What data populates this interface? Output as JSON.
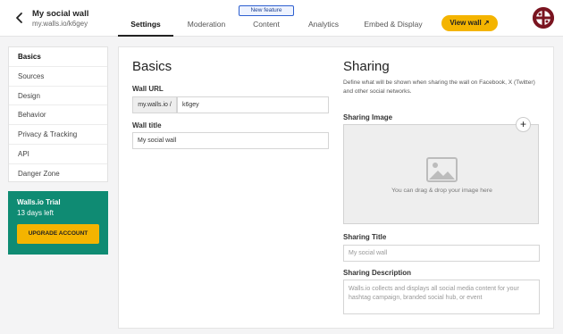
{
  "header": {
    "wall_name": "My social wall",
    "wall_url": "my.walls.io/k6gey",
    "new_feature_badge": "New feature",
    "tabs": [
      {
        "label": "Settings",
        "active": true
      },
      {
        "label": "Moderation",
        "active": false
      },
      {
        "label": "Content",
        "active": false
      },
      {
        "label": "Analytics",
        "active": false
      },
      {
        "label": "Embed & Display",
        "active": false
      }
    ],
    "view_wall_label": "View wall ↗"
  },
  "sidebar": {
    "items": [
      {
        "label": "Basics",
        "active": true
      },
      {
        "label": "Sources",
        "active": false
      },
      {
        "label": "Design",
        "active": false
      },
      {
        "label": "Behavior",
        "active": false
      },
      {
        "label": "Privacy & Tracking",
        "active": false
      },
      {
        "label": "API",
        "active": false
      },
      {
        "label": "Danger Zone",
        "active": false
      }
    ]
  },
  "trial": {
    "title": "Walls.io Trial",
    "days_left": "13 days left",
    "upgrade_label": "UPGRADE ACCOUNT"
  },
  "basics": {
    "heading": "Basics",
    "wall_url_label": "Wall URL",
    "wall_url_prefix": "my.walls.io /",
    "wall_url_value": "k6gey",
    "wall_title_label": "Wall title",
    "wall_title_value": "My social wall"
  },
  "sharing": {
    "heading": "Sharing",
    "description": "Define what will be shown when sharing the wall on Facebook, X (Twitter) and other social networks.",
    "image_label": "Sharing Image",
    "drop_text": "You can drag & drop your image here",
    "title_label": "Sharing Title",
    "title_placeholder": "My social wall",
    "description_label": "Sharing Description",
    "description_placeholder": "Walls.io collects and displays all social media content for your hashtag campaign, branded social hub, or event"
  },
  "colors": {
    "accent": "#f4b400",
    "trial_bg": "#0f8b73",
    "badge_border": "#2d5fd0"
  }
}
